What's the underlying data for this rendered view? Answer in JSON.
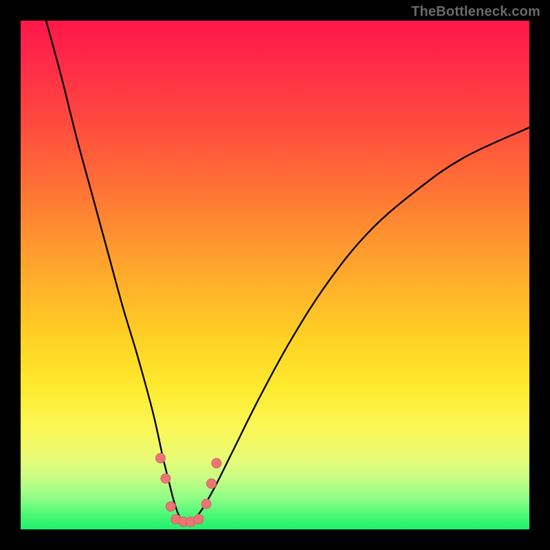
{
  "watermark": {
    "text": "TheBottleneck.com"
  },
  "colors": {
    "background": "#000000",
    "gradient_top": "#ff1749",
    "gradient_bottom": "#1ef06b",
    "curve": "#000000",
    "marker_fill": "#e97575",
    "marker_stroke": "#d66464"
  },
  "chart_data": {
    "type": "line",
    "title": "",
    "xlabel": "",
    "ylabel": "",
    "xlim": [
      0,
      100
    ],
    "ylim": [
      0,
      100
    ],
    "grid": false,
    "legend": false,
    "series": [
      {
        "name": "bottleneck-curve",
        "x": [
          5,
          8,
          11,
          14,
          17,
          20,
          23,
          26,
          28,
          29,
          30,
          31,
          32,
          33,
          35,
          38,
          42,
          47,
          53,
          60,
          68,
          77,
          87,
          100
        ],
        "y": [
          100,
          89,
          77,
          66,
          55,
          44,
          34,
          23,
          14,
          10,
          6,
          3,
          1.5,
          1.5,
          3,
          8,
          16,
          26,
          37,
          48,
          58,
          66,
          73,
          79
        ]
      }
    ],
    "markers": {
      "name": "highlight-dots",
      "points": [
        {
          "x": 27.5,
          "y": 14
        },
        {
          "x": 28.5,
          "y": 10
        },
        {
          "x": 29.5,
          "y": 4.5
        },
        {
          "x": 30.5,
          "y": 2
        },
        {
          "x": 32.0,
          "y": 1.5
        },
        {
          "x": 33.5,
          "y": 1.5
        },
        {
          "x": 35.0,
          "y": 2
        },
        {
          "x": 36.5,
          "y": 5
        },
        {
          "x": 37.5,
          "y": 9
        },
        {
          "x": 38.5,
          "y": 13
        }
      ],
      "radius": 7
    }
  }
}
